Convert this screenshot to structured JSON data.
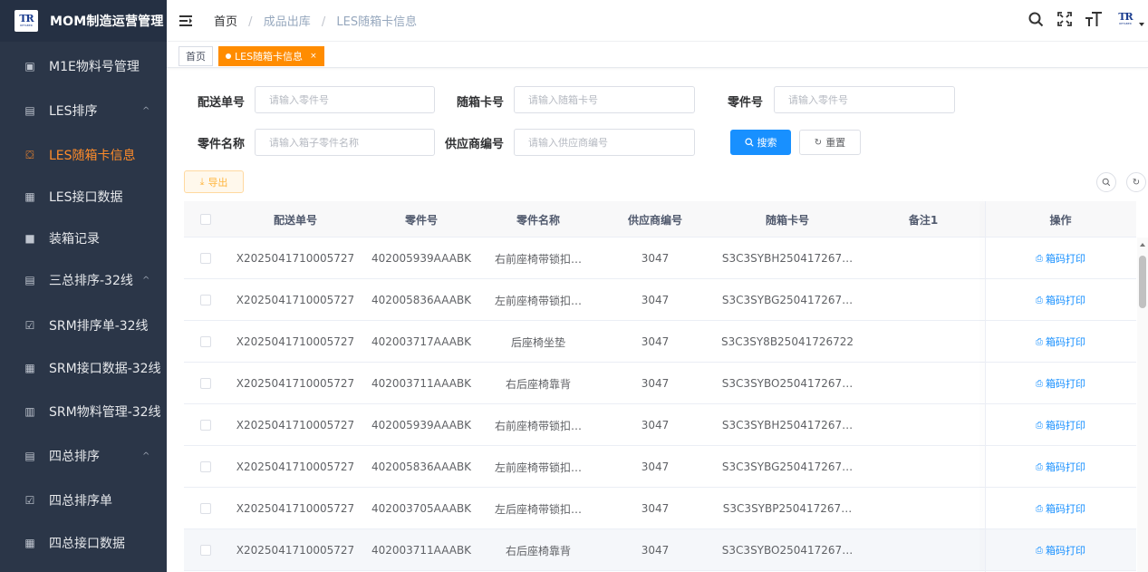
{
  "sidebar": {
    "brand_title": "MOM制造运营管理",
    "logo_text": "TR",
    "logo_sub": "RETABER",
    "items": [
      {
        "label": "M1E物料号管理",
        "icon": "▣",
        "icon_name": "table-icon"
      },
      {
        "label": "LES排序",
        "icon": "▤",
        "icon_name": "list-icon",
        "caret": "^"
      },
      {
        "label": "LES随箱卡信息",
        "icon": "⛋",
        "icon_name": "card-icon",
        "active": true
      },
      {
        "label": "LES接口数据",
        "icon": "▦",
        "icon_name": "grid-icon"
      },
      {
        "label": "装箱记录",
        "icon": "■",
        "icon_name": "box-icon"
      },
      {
        "label": "三总排序-32线",
        "icon": "▤",
        "icon_name": "list-icon",
        "caret": "^"
      },
      {
        "label": "SRM排序单-32线",
        "icon": "☑",
        "icon_name": "checklist-icon"
      },
      {
        "label": "SRM接口数据-32线",
        "icon": "▦",
        "icon_name": "grid-icon"
      },
      {
        "label": "SRM物料管理-32线",
        "icon": "▥",
        "icon_name": "calendar-icon"
      },
      {
        "label": "四总排序",
        "icon": "▤",
        "icon_name": "list-icon",
        "caret": "^"
      },
      {
        "label": "四总排序单",
        "icon": "☑",
        "icon_name": "checklist-icon"
      },
      {
        "label": "四总接口数据",
        "icon": "▦",
        "icon_name": "grid-icon"
      }
    ]
  },
  "topbar": {
    "breadcrumbs": [
      "首页",
      "成品出库",
      "LES随箱卡信息"
    ],
    "separator": "/",
    "icons": [
      "search-icon",
      "fullscreen-icon",
      "font-size-icon"
    ]
  },
  "tags": {
    "home": "首页",
    "active": "LES随箱卡信息",
    "close": "×"
  },
  "filters": {
    "delivery_no": {
      "label": "配送单号",
      "placeholder": "请输入零件号"
    },
    "card_no": {
      "label": "随箱卡号",
      "placeholder": "请输入随箱卡号"
    },
    "part_no": {
      "label": "零件号",
      "placeholder": "请输入零件号"
    },
    "part_name": {
      "label": "零件名称",
      "placeholder": "请输入箱子零件名称"
    },
    "supplier_no": {
      "label": "供应商编号",
      "placeholder": "请输入供应商编号"
    },
    "search_label": "搜索",
    "reset_label": "重置",
    "export_label": "导出"
  },
  "table": {
    "columns": [
      "配送单号",
      "零件号",
      "零件名称",
      "供应商编号",
      "随箱卡号",
      "备注1",
      "操作"
    ],
    "action_label": "箱码打印",
    "rows": [
      {
        "delivery_no": "X2025041710005727",
        "part_no": "402005939AAABK",
        "part_name": "右前座椅带锁扣…",
        "supplier_no": "3047",
        "card_no": "S3C3SYBH250417267…",
        "remark": ""
      },
      {
        "delivery_no": "X2025041710005727",
        "part_no": "402005836AAABK",
        "part_name": "左前座椅带锁扣…",
        "supplier_no": "3047",
        "card_no": "S3C3SYBG250417267…",
        "remark": ""
      },
      {
        "delivery_no": "X2025041710005727",
        "part_no": "402003717AAABK",
        "part_name": "后座椅坐垫",
        "supplier_no": "3047",
        "card_no": "S3C3SY8B25041726722",
        "remark": ""
      },
      {
        "delivery_no": "X2025041710005727",
        "part_no": "402003711AAABK",
        "part_name": "右后座椅靠背",
        "supplier_no": "3047",
        "card_no": "S3C3SYBO250417267…",
        "remark": ""
      },
      {
        "delivery_no": "X2025041710005727",
        "part_no": "402005939AAABK",
        "part_name": "右前座椅带锁扣…",
        "supplier_no": "3047",
        "card_no": "S3C3SYBH250417267…",
        "remark": ""
      },
      {
        "delivery_no": "X2025041710005727",
        "part_no": "402005836AAABK",
        "part_name": "左前座椅带锁扣…",
        "supplier_no": "3047",
        "card_no": "S3C3SYBG250417267…",
        "remark": ""
      },
      {
        "delivery_no": "X2025041710005727",
        "part_no": "402003705AAABK",
        "part_name": "左后座椅带锁扣…",
        "supplier_no": "3047",
        "card_no": "S3C3SYBP250417267…",
        "remark": ""
      },
      {
        "delivery_no": "X2025041710005727",
        "part_no": "402003711AAABK",
        "part_name": "右后座椅靠背",
        "supplier_no": "3047",
        "card_no": "S3C3SYBO250417267…",
        "remark": ""
      }
    ]
  },
  "colors": {
    "sidebar_bg": "#2b3648",
    "accent": "#ff8c00",
    "primary": "#1890ff"
  }
}
